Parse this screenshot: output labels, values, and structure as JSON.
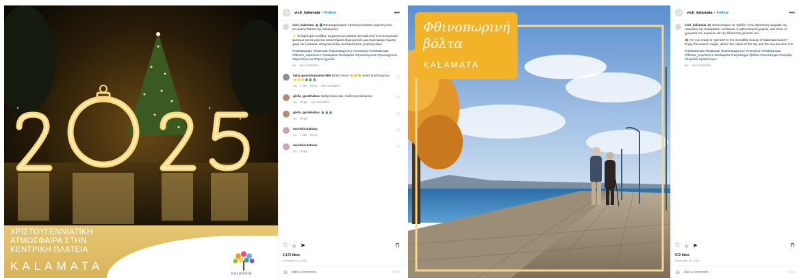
{
  "posts": [
    {
      "account": "visit_kalamata",
      "follow_label": "Follow",
      "more_label": "•••",
      "caption": {
        "username": "visit_kalamata",
        "lead": "🎄🌲Φαντασμαγορική Χριστουγεννιάτικη γιορτινή στην Κεντρική Πλατεία της Καλαμάτας.",
        "body": "✨ Τα λαμπερά στολίδια, τα χριστουγεννιάτικα σκηνικά από το εντυπωσιακό φωτισμό και τα γιορτινά καταστήματα δημιουργούν μια ατμόσφαιρα γεμάτη χαρά και ζεστασιά, απογειώνοντας ανεπανάληπτη γιορτινή αύρα.",
        "tags": "#visitkalamata #kalamata #kalamatagreece #messinia #visitkalamata #lifetime_experience #Καλαμάτα #Καλαμάτα #Χριστούγεννα #Πρωτοχρονιά #Χριστούγεννα #Πρωτοχρονιά",
        "time": "4w",
        "see_translation": "See translation"
      },
      "comments": [
        {
          "user": "takis.apostolopoulos.969",
          "text": "Bravo bravo 👏👏👏 Καλά Χριστούγεννα 🌟🌟🌟🎄🎄🎄",
          "time": "4w",
          "likes": "1 like",
          "reply": "Reply",
          "see_translation": "See translation",
          "avatar_color": "#8c8f96"
        },
        {
          "user": "giella_gardelakou",
          "text": "Καλησπέρα σας, Καλά Χριστούγεννα",
          "time": "4w",
          "reply": "Reply",
          "see_translation": "See translation",
          "avatar_color": "#b58a6e"
        },
        {
          "user": "giella_gardelakou",
          "text": "🎄🎄🎄",
          "time": "4w",
          "reply": "Reply",
          "avatar_color": "#b58a6e"
        },
        {
          "user": "mariddoutatiana",
          "text": "",
          "time": "4w",
          "likes": "1 like",
          "reply": "Reply",
          "avatar_color": "#c9a4b8"
        },
        {
          "user": "mariddoutatiana",
          "text": "",
          "time": "4w",
          "reply": "Reply",
          "avatar_color": "#c9a4b8"
        }
      ],
      "likes": "2,172 likes",
      "date": "December 19, 2024",
      "add_comment_placeholder": "Add a comment...",
      "post_label": "Post",
      "image": {
        "number": "2025",
        "banner_text": "ΧΡΙΣΤΟΥΓΕΝΝΙΑΤΙΚΗ\nΑΤΜΟΣΦΑΙΡΑ ΣΤΗΝ\nΚΕΝΤΡΙΚΗ ΠΛΑΤΕΙΑ",
        "city": "KALAMATA",
        "logo_caption": "KALAMATA"
      }
    },
    {
      "account": "visit_kalamata",
      "follow_label": "Follow",
      "more_label": "•••",
      "caption": {
        "username": "visit_kalamata",
        "lead": "🍂 Είσαι έτοιμος να \"χαθείς\" στην απίστευτη ομορφιά της παραλίας της Καλαμάτας; Απόλαυσε τη φθινοπωρινή μαγεία, εκεί όπου τα χρώματα του ουρανού και της θάλασσας γίνονται ένα.",
        "body": "🍂 Are you ready to \"get lost\" in the incredible beauty of Kalamata beach? Enjoy the autumn magic, where the colors of the sky and the sea become one.",
        "tags": "#visitkalamata #kalamata #kalamatagreece #messinia #visitkalamata #lifetime_experience #Καλαμάτα #περπάτημα #βόλτα #περπάτημα #παραλία #παραλία #φθινόπωρο",
        "time": "6w",
        "see_translation": "See translation"
      },
      "likes": "972 likes",
      "date": "November 19, 2024",
      "add_comment_placeholder": "Add a comment...",
      "post_label": "Post",
      "image": {
        "title": "Φθινοπωρινή βόλτα",
        "city": "KALAMATA"
      }
    }
  ],
  "colors": {
    "gold": "#e0bd5f",
    "follow_blue": "#0095f6",
    "autumn_orange": "#f2b328"
  }
}
